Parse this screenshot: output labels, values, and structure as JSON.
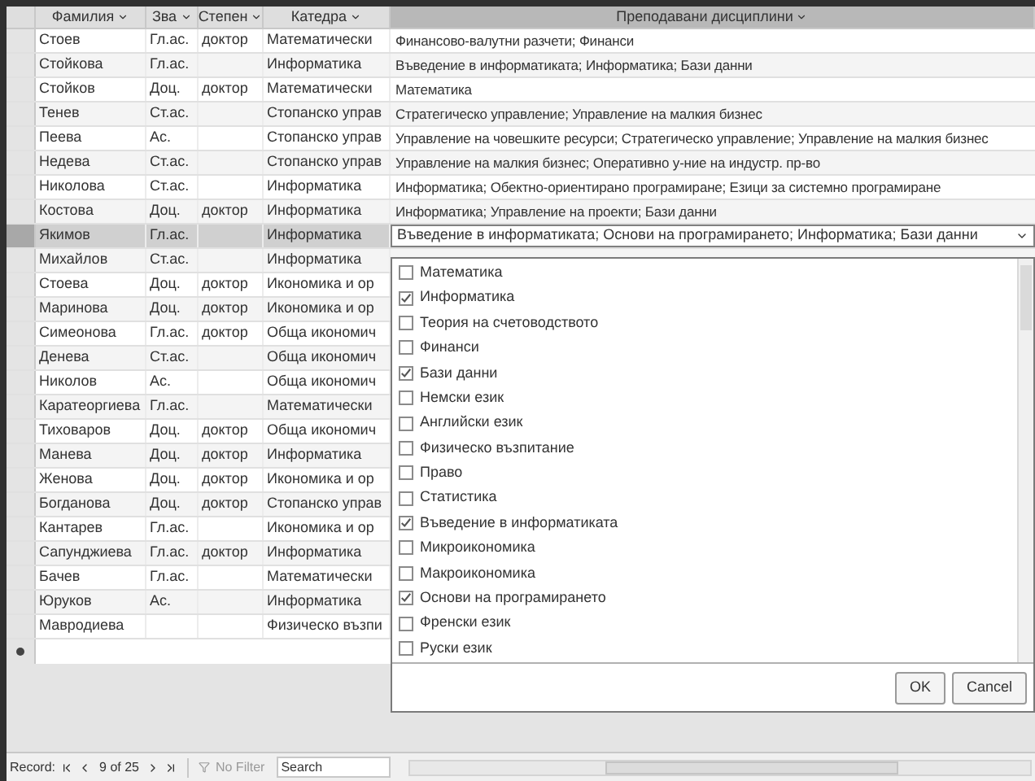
{
  "columns": [
    "Фамилия",
    "Зва",
    "Степен",
    "Катедра",
    "Преподавани дисциплини"
  ],
  "rows": [
    {
      "selected": false,
      "cells": [
        "Стоев",
        "Гл.ас.",
        "доктор",
        "Математически",
        "Финансово-валутни разчети; Финанси"
      ]
    },
    {
      "selected": false,
      "cells": [
        "Стойкова",
        "Гл.ас.",
        "",
        "Информатика",
        "Въведение в информатиката; Информатика; Бази данни"
      ]
    },
    {
      "selected": false,
      "cells": [
        "Стойков",
        "Доц.",
        "доктор",
        "Математически",
        "Математика"
      ]
    },
    {
      "selected": false,
      "cells": [
        "Тенев",
        "Ст.ас.",
        "",
        "Стопанско управ",
        "Стратегическо управление; Управление на малкия бизнес"
      ]
    },
    {
      "selected": false,
      "cells": [
        "Пеева",
        "Ас.",
        "",
        "Стопанско управ",
        "Управление на човешките ресурси; Стратегическо управление; Управление на малкия бизнес"
      ]
    },
    {
      "selected": false,
      "cells": [
        "Недева",
        "Ст.ас.",
        "",
        "Стопанско управ",
        "Управление на малкия бизнес; Оперативно у-ние на индустр. пр-во"
      ]
    },
    {
      "selected": false,
      "cells": [
        "Николова",
        "Ст.ас.",
        "",
        "Информатика",
        "Информатика; Обектно-ориентирано програмиране; Езици за системно програмиране"
      ]
    },
    {
      "selected": false,
      "cells": [
        "Костова",
        "Доц.",
        "доктор",
        "Информатика",
        "Информатика; Управление на проекти; Бази данни"
      ]
    },
    {
      "selected": true,
      "cells": [
        "Якимов",
        "Гл.ас.",
        "",
        "Информатика",
        "Въведение в информатиката; Основи на програмирането; Информатика; Бази данни"
      ]
    },
    {
      "selected": false,
      "cells": [
        "Михайлов",
        "Ст.ас.",
        "",
        "Информатика"
      ]
    },
    {
      "selected": false,
      "cells": [
        "Стоева",
        "Доц.",
        "доктор",
        "Икономика и ор"
      ]
    },
    {
      "selected": false,
      "cells": [
        "Маринова",
        "Доц.",
        "доктор",
        "Икономика и ор"
      ]
    },
    {
      "selected": false,
      "cells": [
        "Симеонова",
        "Гл.ас.",
        "доктор",
        "Обща икономич"
      ]
    },
    {
      "selected": false,
      "cells": [
        "Денева",
        "Ст.ас.",
        "",
        "Обща икономич"
      ]
    },
    {
      "selected": false,
      "cells": [
        "Николов",
        "Ас.",
        "",
        "Обща икономич"
      ]
    },
    {
      "selected": false,
      "cells": [
        "Каратеоргиева",
        "Гл.ас.",
        "",
        "Математически"
      ]
    },
    {
      "selected": false,
      "cells": [
        "Тиховаров",
        "Доц.",
        "доктор",
        "Обща икономич"
      ]
    },
    {
      "selected": false,
      "cells": [
        "Манева",
        "Доц.",
        "доктор",
        "Информатика"
      ]
    },
    {
      "selected": false,
      "cells": [
        "Женова",
        "Доц.",
        "доктор",
        "Икономика и ор"
      ]
    },
    {
      "selected": false,
      "cells": [
        "Богданова",
        "Доц.",
        "доктор",
        "Стопанско управ"
      ]
    },
    {
      "selected": false,
      "cells": [
        "Кантарев",
        "Гл.ас.",
        "",
        "Икономика и ор"
      ]
    },
    {
      "selected": false,
      "cells": [
        "Сапунджиева",
        "Гл.ас.",
        "доктор",
        "Информатика"
      ]
    },
    {
      "selected": false,
      "cells": [
        "Бачев",
        "Гл.ас.",
        "",
        "Математически"
      ]
    },
    {
      "selected": false,
      "cells": [
        "Юруков",
        "Ас.",
        "",
        "Информатика"
      ]
    },
    {
      "selected": false,
      "cells": [
        "Мавродиева",
        "",
        "",
        "Физическо възпи"
      ]
    }
  ],
  "dropdown": {
    "options": [
      {
        "label": "Математика",
        "checked": false
      },
      {
        "label": "Информатика",
        "checked": true
      },
      {
        "label": "Теория на счетоводството",
        "checked": false
      },
      {
        "label": "Финанси",
        "checked": false
      },
      {
        "label": "Бази данни",
        "checked": true
      },
      {
        "label": "Немски език",
        "checked": false
      },
      {
        "label": "Английски език",
        "checked": false
      },
      {
        "label": "Физическо възпитание",
        "checked": false
      },
      {
        "label": "Право",
        "checked": false
      },
      {
        "label": "Статистика",
        "checked": false
      },
      {
        "label": "Въведение в информатиката",
        "checked": true
      },
      {
        "label": "Микроикономика",
        "checked": false
      },
      {
        "label": "Макроикономика",
        "checked": false
      },
      {
        "label": "Основи на програмирането",
        "checked": true
      },
      {
        "label": "Френски език",
        "checked": false
      },
      {
        "label": "Руски език",
        "checked": false
      }
    ],
    "buttons": [
      "OK",
      "Cancel"
    ]
  },
  "status_bar": {
    "label": "Record:",
    "position": "9 of 25",
    "filter": "No Filter",
    "search": "Search"
  }
}
